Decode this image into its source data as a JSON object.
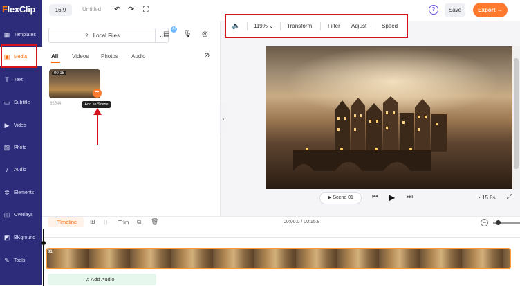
{
  "app": {
    "logo_f": "F",
    "logo_rest": "lexClip"
  },
  "sidebar": {
    "items": [
      {
        "label": "Templates",
        "icon": "template-icon"
      },
      {
        "label": "Media",
        "icon": "media-icon"
      },
      {
        "label": "Text",
        "icon": "text-icon"
      },
      {
        "label": "Subtitle",
        "icon": "subtitle-icon"
      },
      {
        "label": "Video",
        "icon": "video-icon"
      },
      {
        "label": "Photo",
        "icon": "photo-icon"
      },
      {
        "label": "Audio",
        "icon": "audio-icon"
      },
      {
        "label": "Elements",
        "icon": "elements-icon"
      },
      {
        "label": "Overlays",
        "icon": "overlays-icon"
      },
      {
        "label": "BKground",
        "icon": "background-icon"
      },
      {
        "label": "Tools",
        "icon": "tools-icon"
      }
    ],
    "active": "Media"
  },
  "topbar": {
    "ratio": "16:9",
    "title": "Untitled",
    "help": "?",
    "save_label": "Save",
    "export_label": "Export →"
  },
  "panel": {
    "local_files_label": "Local Files",
    "ai_badge": "AI",
    "tabs": [
      "All",
      "Videos",
      "Photos",
      "Audio"
    ],
    "active_tab": "All",
    "media_item": {
      "duration": "00:15",
      "name": "65644"
    },
    "tooltip": "Add as Scene"
  },
  "edit_toolbar": {
    "zoom": "119%",
    "transform": "Transform",
    "filter": "Filter",
    "adjust": "Adjust",
    "speed": "Speed"
  },
  "player": {
    "scene_label": "Scene 01",
    "duration": "15.8s"
  },
  "timeline": {
    "label": "Timeline",
    "trim_label": "Trim",
    "time": "00:00.0 / 00:15.8",
    "clip_number": "01",
    "add_audio_label": "Add Audio"
  },
  "colors": {
    "sidebar_bg": "#2c2c7a",
    "accent": "#ff7a2e",
    "highlight_red": "#d6131d"
  }
}
